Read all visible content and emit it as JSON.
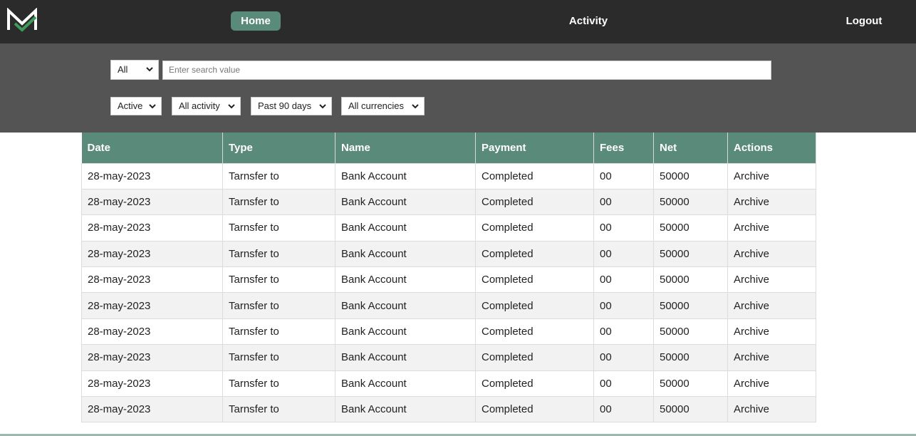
{
  "nav": {
    "home_label": "Home",
    "activity_label": "Activity",
    "logout_label": "Logout"
  },
  "filters": {
    "scope_select": "All",
    "search_placeholder": "Enter search value",
    "status_select": "Active",
    "activity_select": "All activity",
    "period_select": "Past 90 days",
    "currency_select": "All currencies"
  },
  "colors": {
    "topbar": "#2b2b2b",
    "filterbar": "#545454",
    "accent": "#5a8a7a"
  },
  "table": {
    "headers": [
      "Date",
      "Type",
      "Name",
      "Payment",
      "Fees",
      "Net",
      "Actions"
    ],
    "rows": [
      [
        "28-may-2023",
        "Tarnsfer to",
        "Bank Account",
        "Completed",
        "00",
        "50000",
        "Archive"
      ],
      [
        "28-may-2023",
        "Tarnsfer to",
        "Bank Account",
        "Completed",
        "00",
        "50000",
        "Archive"
      ],
      [
        "28-may-2023",
        "Tarnsfer to",
        "Bank Account",
        "Completed",
        "00",
        "50000",
        "Archive"
      ],
      [
        "28-may-2023",
        "Tarnsfer to",
        "Bank Account",
        "Completed",
        "00",
        "50000",
        "Archive"
      ],
      [
        "28-may-2023",
        "Tarnsfer to",
        "Bank Account",
        "Completed",
        "00",
        "50000",
        "Archive"
      ],
      [
        "28-may-2023",
        "Tarnsfer to",
        "Bank Account",
        "Completed",
        "00",
        "50000",
        "Archive"
      ],
      [
        "28-may-2023",
        "Tarnsfer to",
        "Bank Account",
        "Completed",
        "00",
        "50000",
        "Archive"
      ],
      [
        "28-may-2023",
        "Tarnsfer to",
        "Bank Account",
        "Completed",
        "00",
        "50000",
        "Archive"
      ],
      [
        "28-may-2023",
        "Tarnsfer to",
        "Bank Account",
        "Completed",
        "00",
        "50000",
        "Archive"
      ],
      [
        "28-may-2023",
        "Tarnsfer to",
        "Bank Account",
        "Completed",
        "00",
        "50000",
        "Archive"
      ]
    ]
  }
}
